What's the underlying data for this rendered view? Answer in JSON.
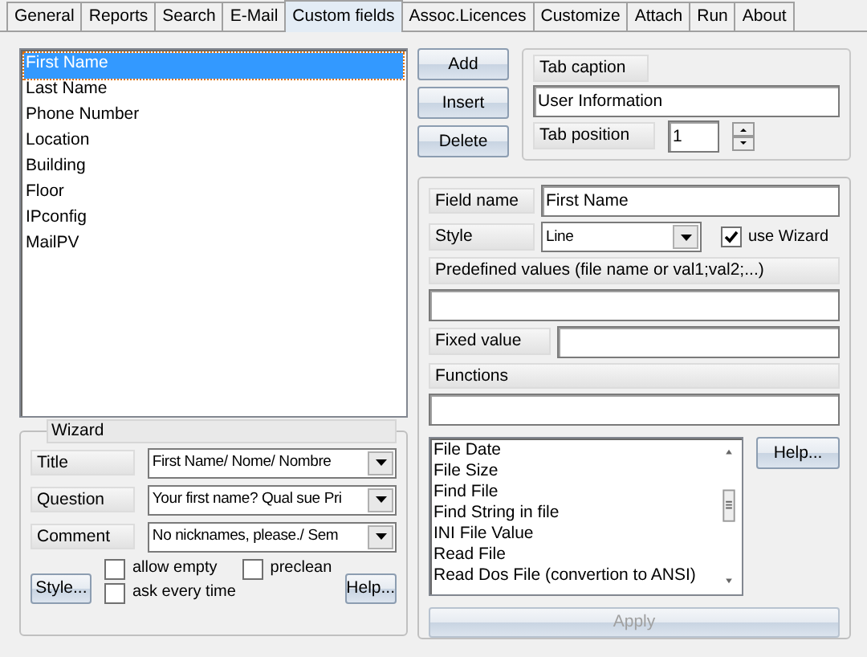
{
  "tabs": [
    {
      "label": "General",
      "selected": false
    },
    {
      "label": "Reports",
      "selected": false
    },
    {
      "label": "Search",
      "selected": false
    },
    {
      "label": "E-Mail",
      "selected": false
    },
    {
      "label": "Custom fields",
      "selected": true
    },
    {
      "label": "Assoc.Licences",
      "selected": false
    },
    {
      "label": "Customize",
      "selected": false
    },
    {
      "label": "Attach",
      "selected": false
    },
    {
      "label": "Run",
      "selected": false
    },
    {
      "label": "About",
      "selected": false
    }
  ],
  "fields_list": [
    {
      "label": "First Name",
      "selected": true
    },
    {
      "label": "Last Name",
      "selected": false
    },
    {
      "label": "Phone Number",
      "selected": false
    },
    {
      "label": "Location",
      "selected": false
    },
    {
      "label": "Building",
      "selected": false
    },
    {
      "label": "Floor",
      "selected": false
    },
    {
      "label": "IPconfig",
      "selected": false
    },
    {
      "label": "MailPV",
      "selected": false
    }
  ],
  "list_buttons": [
    "Add",
    "Insert",
    "Delete"
  ],
  "tab_caption": {
    "label": "Tab caption",
    "value": "User Information"
  },
  "tab_position": {
    "label": "Tab position",
    "value": "1"
  },
  "field_name": {
    "label": "Field name",
    "value": "First Name"
  },
  "style": {
    "label": "Style",
    "value": "Line"
  },
  "use_wizard": {
    "label": "use Wizard",
    "checked": true
  },
  "predefined_values": {
    "label": "Predefined values (file name or val1;val2;...)"
  },
  "fixed_value": {
    "label": "Fixed value"
  },
  "functions": {
    "label": "Functions",
    "items": [
      "File Date",
      "File Size",
      "Find File",
      "Find String in file",
      "INI File Value",
      "Read File",
      "Read Dos File (convertion to ANSI)"
    ],
    "help_button": "Help..."
  },
  "apply": {
    "label": "Apply",
    "disabled": true
  },
  "wizard": {
    "title": "Wizard",
    "rows": [
      {
        "label": "Title",
        "value": "First Name/ Nome/ Nombre"
      },
      {
        "label": "Question",
        "value": "Your first name? Qual sue Pri"
      },
      {
        "label": "Comment",
        "value": "No nicknames, please./ Sem"
      }
    ],
    "checkboxes": [
      {
        "label": "allow empty",
        "checked": false
      },
      {
        "label": "preclean",
        "checked": false
      },
      {
        "label": "ask every time",
        "checked": false
      }
    ],
    "style_button": "Style...",
    "help_button": "Help..."
  }
}
